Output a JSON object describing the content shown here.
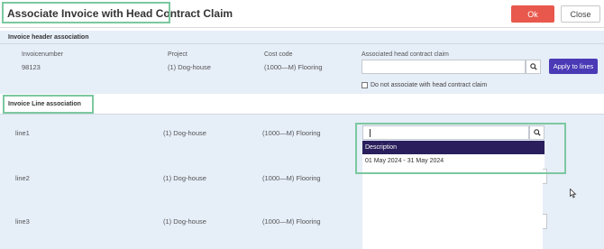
{
  "dialog": {
    "title": "Associate Invoice with Head Contract Claim",
    "ok_label": "Ok",
    "close_label": "Close"
  },
  "header_section": {
    "title": "Invoice header association",
    "columns": {
      "invoice_number": "Invoicenumber",
      "project": "Project",
      "cost_code": "Cost code",
      "associated_claim": "Associated head contract claim"
    },
    "row": {
      "invoice_number": "98123",
      "project": "(1) Dog-house",
      "cost_code": "(1000—M) Flooring"
    },
    "claim_input_value": "",
    "apply_label": "Apply to lines",
    "do_not_associate_label": "Do not associate with head contract claim",
    "do_not_associate_checked": false
  },
  "line_section": {
    "title": "Invoice Line association",
    "lines": [
      {
        "name": "line1",
        "project": "(1) Dog-house",
        "cost_code": "(1000—M) Flooring"
      },
      {
        "name": "line2",
        "project": "(1) Dog-house",
        "cost_code": "(1000—M) Flooring"
      },
      {
        "name": "line3",
        "project": "(1) Dog-house",
        "cost_code": "(1000—M) Flooring"
      }
    ],
    "dropdown": {
      "input_value": "",
      "header": "Description",
      "options": [
        "01 May 2024 - 31 May 2024"
      ]
    }
  },
  "colors": {
    "ok": "#e8584c",
    "apply": "#4a3ab5",
    "dropdown_header": "#2a1f5c",
    "band": "#e6eef8",
    "highlight": "#7cc8a0"
  },
  "icons": [
    "search-icon",
    "mouse-cursor-icon"
  ]
}
